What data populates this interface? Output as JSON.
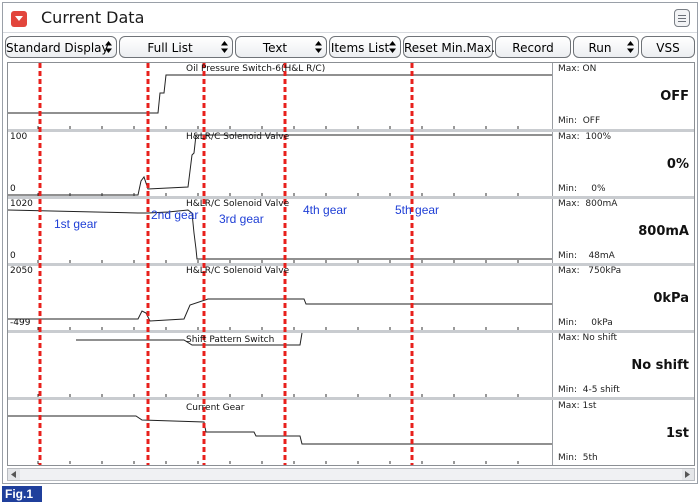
{
  "window": {
    "title": "Current Data",
    "title_icon": "dropdown-arrow-icon",
    "menu_icon": "hamburger-menu-icon"
  },
  "toolbar": {
    "display_mode": "Standard Display",
    "list_mode": "Full List",
    "view_mode": "Text",
    "items_list": "Items List",
    "reset_minmax": "Reset Min.Max.",
    "record": "Record",
    "run": "Run",
    "vss": "VSS"
  },
  "panels": [
    {
      "title": "Oil Pressure Switch-6(H&L R/C)",
      "y_top": "",
      "y_bottom": "",
      "max": "Max: ON",
      "min": "Min:  OFF",
      "current": "OFF"
    },
    {
      "title": "H&LR/C Solenoid Valve",
      "y_top": "100",
      "y_bottom": "0",
      "max": "Max:  100%",
      "min": "Min:     0%",
      "current": "0%"
    },
    {
      "title": "H&LR/C Solenoid Valve",
      "y_top": "1020",
      "y_bottom": "0",
      "max": "Max:  800mA",
      "min": "Min:    48mA",
      "current": "800mA"
    },
    {
      "title": "H&LR/C Solenoid Valve",
      "y_top": "2050",
      "y_bottom": "-499",
      "max": "Max:   750kPa",
      "min": "Min:     0kPa",
      "current": "0kPa"
    },
    {
      "title": "Shift Pattern Switch",
      "y_top": "",
      "y_bottom": "",
      "max": "Max: No shift",
      "min": "Min:  4-5 shift",
      "current": "No shift"
    },
    {
      "title": "Current Gear",
      "y_top": "",
      "y_bottom": "",
      "max": "Max: 1st",
      "min": "Min:  5th",
      "current": "1st"
    }
  ],
  "gear_annotations": [
    "1st gear",
    "2nd gear",
    "3rd gear",
    "4th gear",
    "5th gear"
  ],
  "colors": {
    "gear_marker": "#e8201c",
    "gear_label": "#1f3fd6",
    "trace": "#222222",
    "fig_badge": "#1f3f9c"
  },
  "figure_label": "Fig.1"
}
